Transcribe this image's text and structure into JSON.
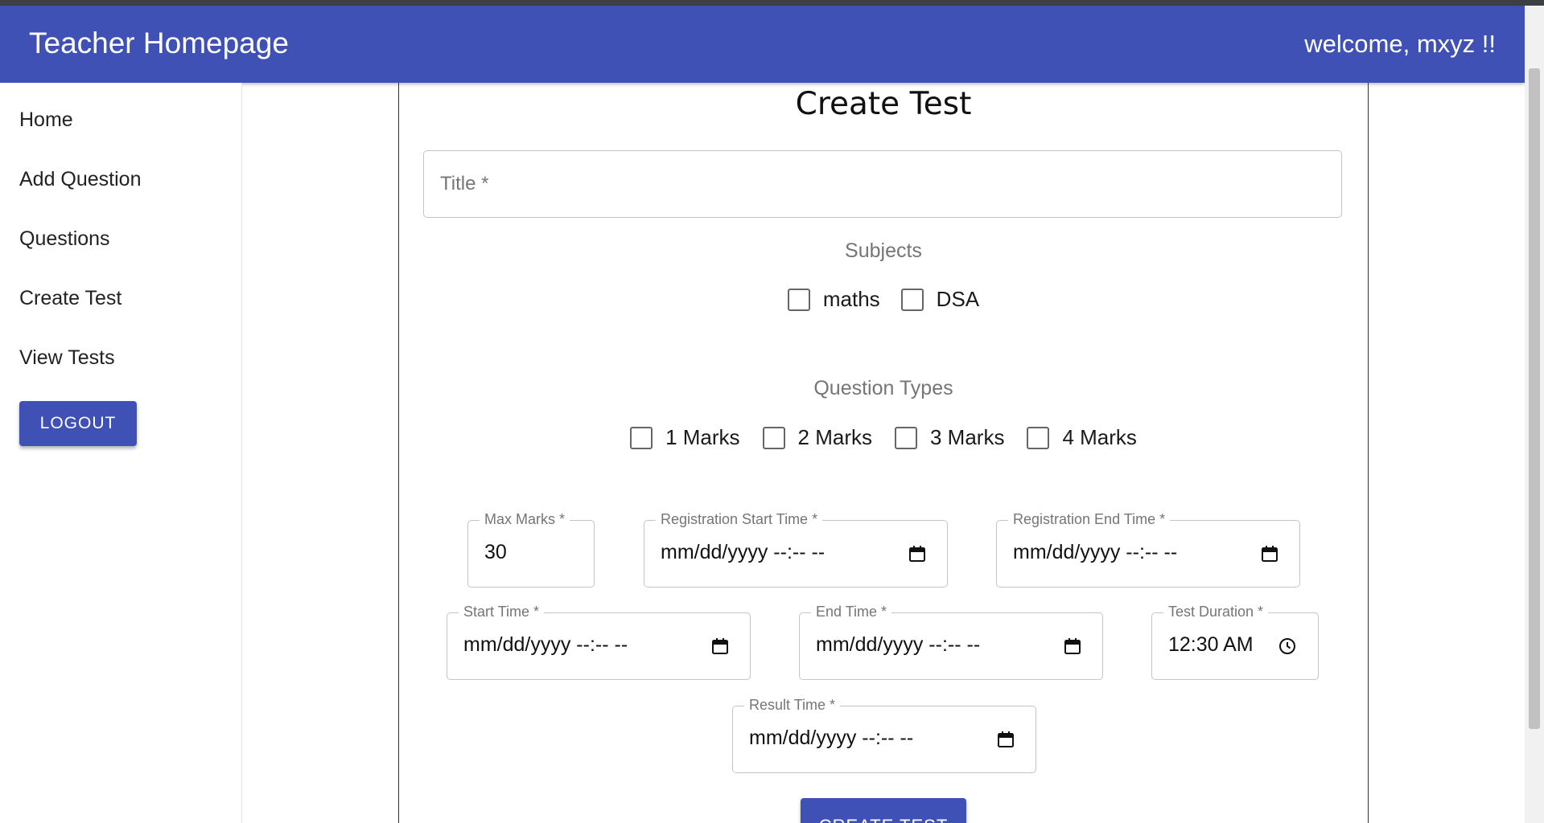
{
  "header": {
    "title": "Teacher Homepage",
    "welcome": "welcome, mxyz !!",
    "color": "#3f51b5"
  },
  "sidebar": {
    "items": [
      {
        "label": "Home"
      },
      {
        "label": "Add Question"
      },
      {
        "label": "Questions"
      },
      {
        "label": "Create Test"
      },
      {
        "label": "View Tests"
      }
    ],
    "logout_label": "LOGOUT"
  },
  "form": {
    "heading": "Create Test",
    "title_placeholder": "Title *",
    "subjects_label": "Subjects",
    "subjects": [
      {
        "label": "maths",
        "checked": false
      },
      {
        "label": "DSA",
        "checked": false
      }
    ],
    "question_types_label": "Question Types",
    "question_types": [
      {
        "label": "1 Marks",
        "checked": false
      },
      {
        "label": "2 Marks",
        "checked": false
      },
      {
        "label": "3 Marks",
        "checked": false
      },
      {
        "label": "4 Marks",
        "checked": false
      }
    ],
    "max_marks": {
      "label": "Max Marks *",
      "value": "30"
    },
    "registration_start": {
      "label": "Registration Start Time *",
      "value": "mm/dd/yyyy --:-- --"
    },
    "registration_end": {
      "label": "Registration End Time *",
      "value": "mm/dd/yyyy --:-- --"
    },
    "start_time": {
      "label": "Start Time *",
      "value": "mm/dd/yyyy --:-- --"
    },
    "end_time": {
      "label": "End Time *",
      "value": "mm/dd/yyyy --:-- --"
    },
    "test_duration": {
      "label": "Test Duration *",
      "value": "12:30 AM"
    },
    "result_time": {
      "label": "Result Time *",
      "value": "mm/dd/yyyy --:-- --"
    },
    "submit_label": "CREATE TEST"
  }
}
